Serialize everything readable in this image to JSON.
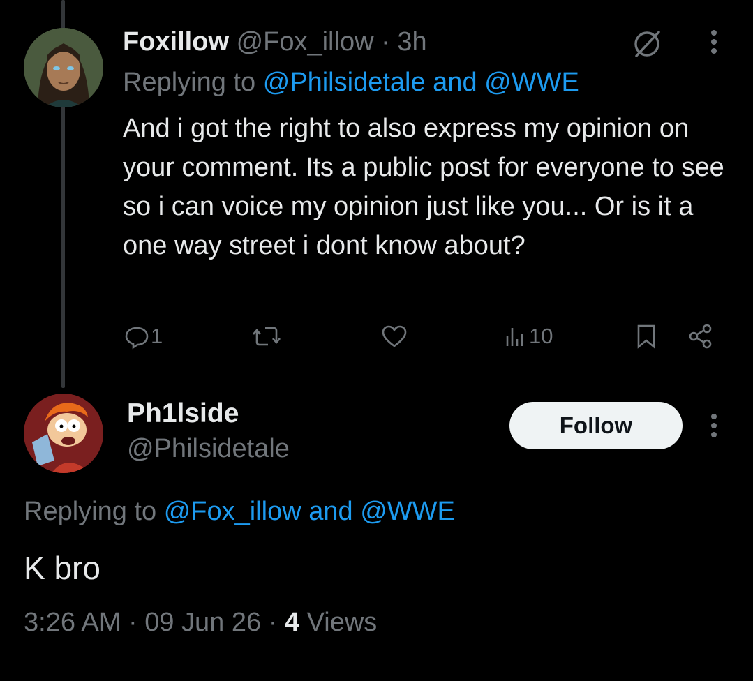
{
  "tweet1": {
    "display_name": "Foxillow",
    "handle": "@Fox_illow",
    "separator": "·",
    "time": "3h",
    "replying_prefix": "Replying to",
    "replying_user1": "@Philsidetale",
    "replying_and": "and",
    "replying_user2": "@WWE",
    "text": "And i got the right to also express my opinion on your comment. Its a public post for everyone to see so i can voice my opinion just like you... Or is it a one way street i dont know about?",
    "reply_count": "1",
    "view_count": "10",
    "icons": [
      "grok-icon",
      "more-icon",
      "reply-icon",
      "retweet-icon",
      "like-icon",
      "views-icon",
      "bookmark-icon",
      "share-icon"
    ]
  },
  "tweet2": {
    "display_name": "Ph1lside",
    "handle": "@Philsidetale",
    "follow_label": "Follow",
    "replying_prefix": "Replying to",
    "replying_user1": "@Fox_illow",
    "replying_and": "and",
    "replying_user2": "@WWE",
    "text": "K bro",
    "time": "3:26 AM",
    "separator": "·",
    "date": "09 Jun 26",
    "views_count": "4",
    "views_label": "Views"
  },
  "colors": {
    "background": "#000000",
    "text": "#e7e9ea",
    "muted": "#71767b",
    "link": "#1d9bf0",
    "follow_bg": "#eff3f4"
  }
}
